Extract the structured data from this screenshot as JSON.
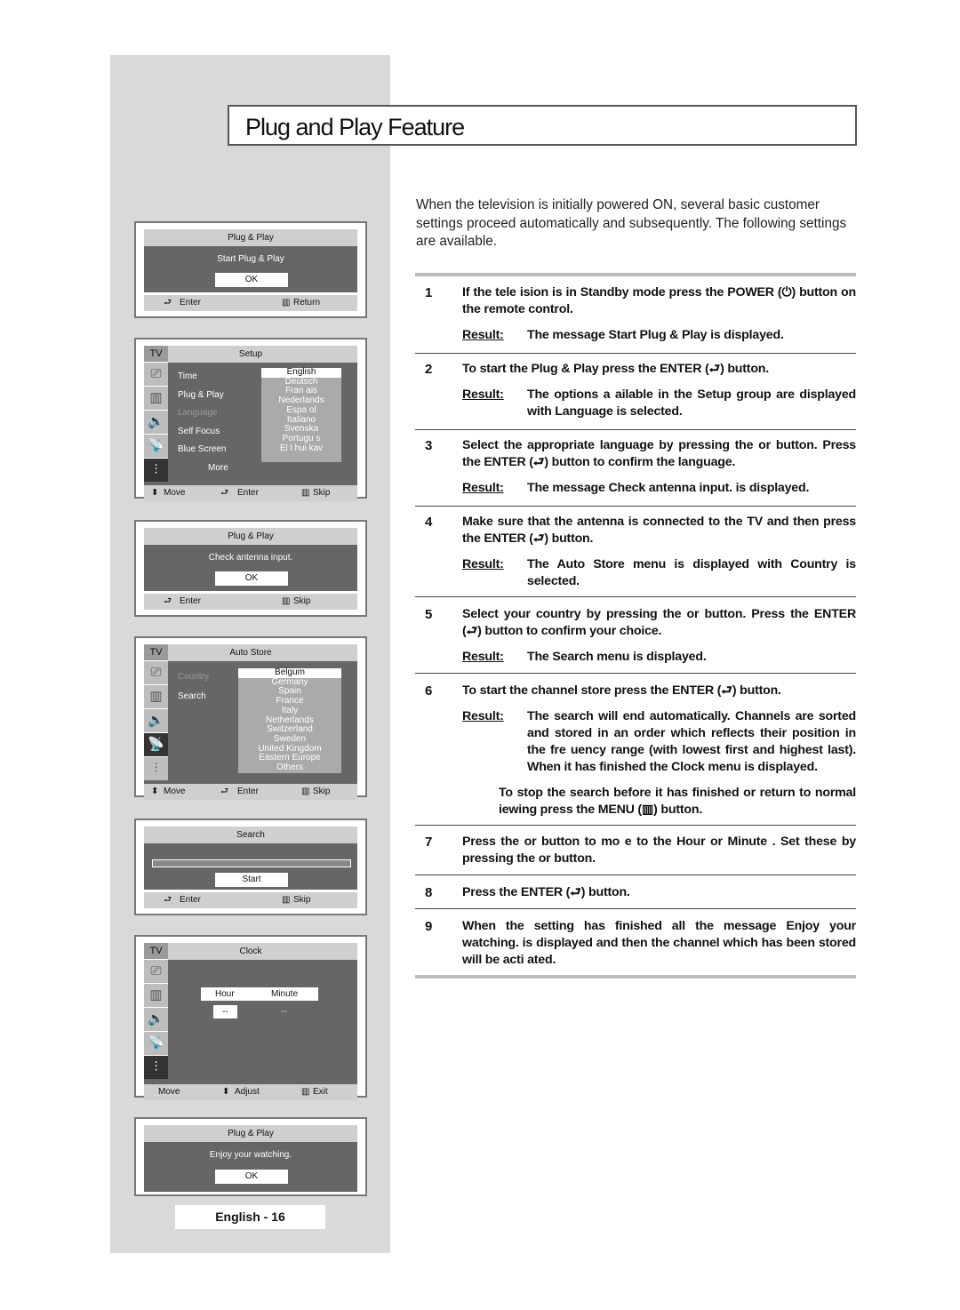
{
  "title": "Plug and Play Feature",
  "intro": "When the television is initially powered ON, several basic customer settings proceed automatically and subsequently. The following settings are available.",
  "footer_page": "English - 16",
  "screens": {
    "p1": {
      "header": "Plug & Play",
      "message": "Start Plug & Play",
      "ok": "OK",
      "left": "Enter",
      "right": "Return"
    },
    "setup": {
      "tv": "TV",
      "header": "Setup",
      "items": [
        "Time",
        "Plug & Play",
        "Language",
        "Self Focus",
        "Blue Screen",
        "More"
      ],
      "colon": ":",
      "languages": [
        "English",
        "Deutsch",
        "Fran ais",
        "Nederlands",
        "Espa ol",
        "Italiano",
        "Svenska",
        "Portugu s",
        "El l hui kav"
      ],
      "f1": "Move",
      "f2": "Enter",
      "f3": "Skip"
    },
    "p3": {
      "header": "Plug & Play",
      "message": "Check antenna input.",
      "ok": "OK",
      "left": "Enter",
      "right": "Skip"
    },
    "auto": {
      "tv": "TV",
      "header": "Auto Store",
      "items": [
        "Country",
        "Search"
      ],
      "colon": ":",
      "countries": [
        "Belgum",
        "Germany",
        "Spain",
        "France",
        "Italy",
        "Netherlands",
        "Switzerland",
        "Sweden",
        "United Kingdom",
        "Eastern Europe",
        "Others"
      ],
      "f1": "Move",
      "f2": "Enter",
      "f3": "Skip"
    },
    "search": {
      "header": "Search",
      "start": "Start",
      "left": "Enter",
      "right": "Skip"
    },
    "clock": {
      "tv": "TV",
      "header": "Clock",
      "hour": "Hour",
      "minute": "Minute",
      "hour_val": "--",
      "minute_val": "--",
      "f1": "Move",
      "f2": "Adjust",
      "f3": "Exit"
    },
    "p7": {
      "header": "Plug & Play",
      "message": "Enjoy your watching.",
      "ok": "OK"
    }
  },
  "result_label": "Result:",
  "steps": [
    {
      "n": "1",
      "text": "If the tele ision is in Standby mode press the POWER (⏻) button on the remote control.",
      "result": "The message Start Plug & Play is displayed."
    },
    {
      "n": "2",
      "text": "To start the Plug & Play press the ENTER (⮐) button.",
      "result": "The options a ailable in the Setup group are displayed with Language is selected."
    },
    {
      "n": "3",
      "text": "Select the appropriate language by pressing the or button. Press the ENTER (⮐) button to confirm the language.",
      "result": "The message Check antenna input. is displayed."
    },
    {
      "n": "4",
      "text": "Make sure that the antenna is connected to the TV and then press the ENTER (⮐) button.",
      "result": "The Auto Store menu is displayed with Country is selected."
    },
    {
      "n": "5",
      "text": "Select your country by pressing the or button. Press the ENTER (⮐) button to confirm your choice.",
      "result": "The Search menu is displayed."
    },
    {
      "n": "6",
      "text": "To start the channel store press the ENTER (⮐) button.",
      "result": "The search will end automatically. Channels are sorted and stored in an order which reflects their position in the fre uency range (with lowest first and highest last). When it has finished the Clock menu is displayed.",
      "note": "To stop the search before it has finished or return to normal iewing press the MENU (▥) button."
    },
    {
      "n": "7",
      "text": "Press the or button to mo e to the Hour or Minute . Set these by pressing the or button."
    },
    {
      "n": "8",
      "text": "Press the ENTER (⮐) button."
    },
    {
      "n": "9",
      "text": "When the setting has finished all the message Enjoy your watching. is displayed and then the channel which has been stored will be acti ated."
    }
  ]
}
